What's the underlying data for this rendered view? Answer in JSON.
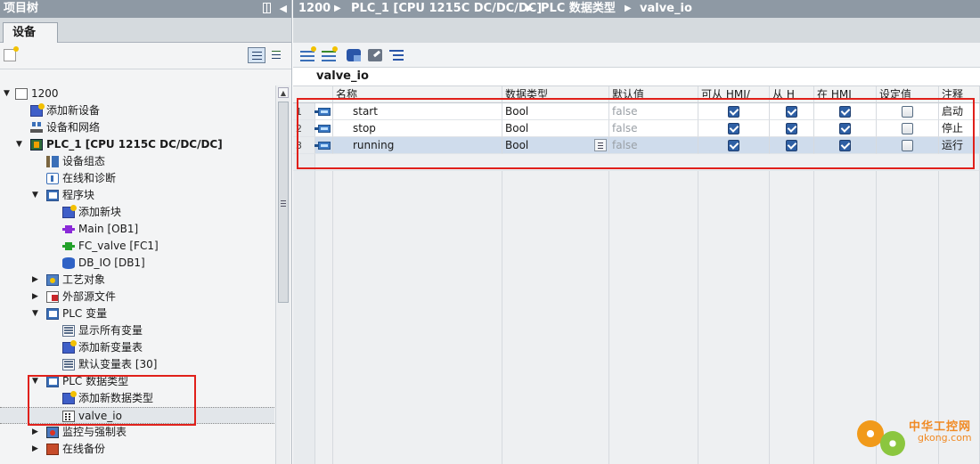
{
  "left_panel": {
    "title": "项目树",
    "collapse_symbol": "◀",
    "tab_label": "设备",
    "tree": [
      {
        "label": "1200",
        "arrow": "▼",
        "icon": "page-icon",
        "bold": false
      },
      {
        "label": "添加新设备",
        "arrow": "",
        "icon": "add-device-icon",
        "bold": false
      },
      {
        "label": "设备和网络",
        "arrow": "",
        "icon": "network-icon",
        "bold": false
      },
      {
        "label": "PLC_1 [CPU 1215C DC/DC/DC]",
        "arrow": "▼",
        "icon": "plc-icon",
        "bold": true
      },
      {
        "label": "设备组态",
        "arrow": "",
        "icon": "device-config-icon",
        "bold": false
      },
      {
        "label": "在线和诊断",
        "arrow": "",
        "icon": "diagnostics-icon",
        "bold": false
      },
      {
        "label": "程序块",
        "arrow": "▼",
        "icon": "folder-icon",
        "bold": false
      },
      {
        "label": "添加新块",
        "arrow": "",
        "icon": "add-block-icon",
        "bold": false
      },
      {
        "label": "Main [OB1]",
        "arrow": "",
        "icon": "ob-block-icon",
        "bold": false
      },
      {
        "label": "FC_valve [FC1]",
        "arrow": "",
        "icon": "fc-block-icon",
        "bold": false
      },
      {
        "label": "DB_IO [DB1]",
        "arrow": "",
        "icon": "db-block-icon",
        "bold": false
      },
      {
        "label": "工艺对象",
        "arrow": "▶",
        "icon": "technology-object-icon",
        "bold": false
      },
      {
        "label": "外部源文件",
        "arrow": "▶",
        "icon": "external-source-icon",
        "bold": false
      },
      {
        "label": "PLC 变量",
        "arrow": "▼",
        "icon": "plc-tags-folder-icon",
        "bold": false
      },
      {
        "label": "显示所有变量",
        "arrow": "",
        "icon": "show-all-tags-icon",
        "bold": false
      },
      {
        "label": "添加新变量表",
        "arrow": "",
        "icon": "add-tag-table-icon",
        "bold": false
      },
      {
        "label": "默认变量表 [30]",
        "arrow": "",
        "icon": "tag-table-icon",
        "bold": false
      },
      {
        "label": "PLC 数据类型",
        "arrow": "▼",
        "icon": "plc-data-types-folder-icon",
        "bold": false
      },
      {
        "label": "添加新数据类型",
        "arrow": "",
        "icon": "add-data-type-icon",
        "bold": false
      },
      {
        "label": "valve_io",
        "arrow": "",
        "icon": "udt-icon",
        "bold": false
      },
      {
        "label": "监控与强制表",
        "arrow": "▶",
        "icon": "watch-force-table-icon",
        "bold": false
      },
      {
        "label": "在线备份",
        "arrow": "▶",
        "icon": "online-backup-icon",
        "bold": false
      }
    ]
  },
  "breadcrumb": {
    "items": [
      "1200",
      "PLC_1 [CPU 1215C DC/DC/DC]",
      "PLC 数据类型",
      "valve_io"
    ],
    "separator": "▶"
  },
  "editor": {
    "title": "valve_io",
    "columns": [
      "名称",
      "数据类型",
      "默认值",
      "可从 HMI/",
      "从 H",
      "在 HMI",
      "设定值",
      "注释"
    ],
    "rows": [
      {
        "num": "1",
        "name": "start",
        "type": "Bool",
        "default": "false",
        "hmi_access": true,
        "from_hmi": true,
        "in_hmi": true,
        "setpoint": false,
        "comment": "启动"
      },
      {
        "num": "2",
        "name": "stop",
        "type": "Bool",
        "default": "false",
        "hmi_access": true,
        "from_hmi": true,
        "in_hmi": true,
        "setpoint": false,
        "comment": "停止"
      },
      {
        "num": "3",
        "name": "running",
        "type": "Bool",
        "default": "false",
        "hmi_access": true,
        "from_hmi": true,
        "in_hmi": true,
        "setpoint": false,
        "comment": "运行"
      }
    ]
  },
  "watermark": {
    "cn": "中华工控网",
    "url": "gkong.com"
  },
  "colors": {
    "title_bar": "#8e99a4",
    "highlight": "#e0201a",
    "selected_row": "#cfdcec",
    "checkbox_on": "#2e5fa4"
  }
}
